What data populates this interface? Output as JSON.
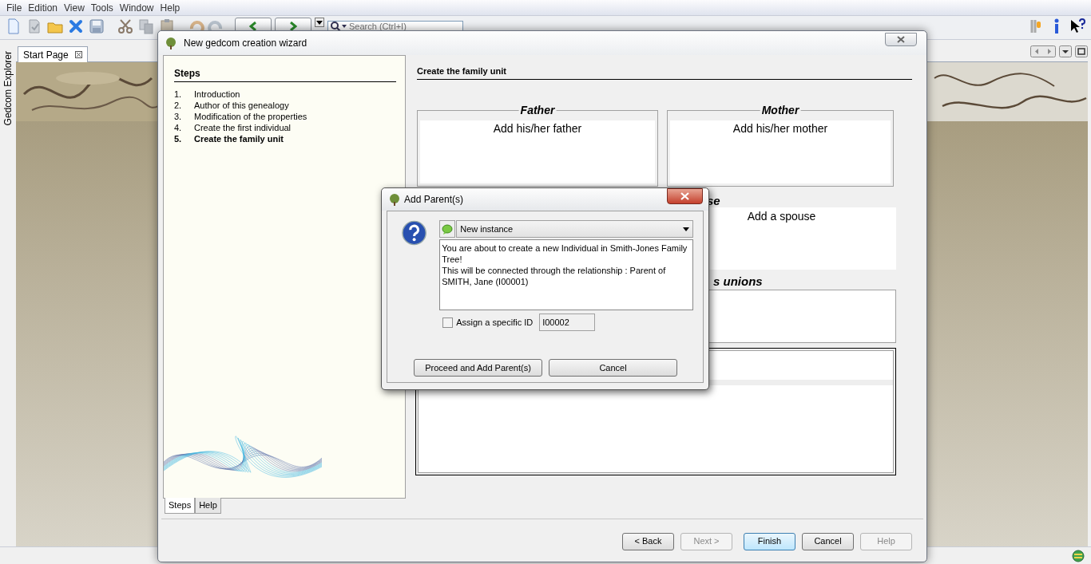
{
  "menu": [
    {
      "label": "File"
    },
    {
      "label": "Edition"
    },
    {
      "label": "View"
    },
    {
      "label": "Tools"
    },
    {
      "label": "Window"
    },
    {
      "label": "Help"
    }
  ],
  "toolbar": {
    "search": {
      "placeholder": "Search (Ctrl+I)"
    }
  },
  "side_tab": {
    "label": "Gedcom Explorer"
  },
  "document_tabs": [
    {
      "label": "Start Page",
      "selected": true
    }
  ],
  "wizard": {
    "title": "New gedcom creation wizard",
    "steps_title": "Steps",
    "steps": [
      {
        "number": "1.",
        "label": "Introduction",
        "selected": false
      },
      {
        "number": "2.",
        "label": "Author of this genealogy",
        "selected": false
      },
      {
        "number": "3.",
        "label": "Modification of the properties",
        "selected": false
      },
      {
        "number": "4.",
        "label": "Create the first individual",
        "selected": false
      },
      {
        "number": "5.",
        "label": "Create the family unit",
        "selected": true
      }
    ],
    "panel_tabs": [
      {
        "label": "Steps",
        "selected": true
      },
      {
        "label": "Help",
        "selected": false
      }
    ],
    "heading": "Create the family unit",
    "father": {
      "title": "Father",
      "action": "Add his/her father"
    },
    "mother": {
      "title": "Mother",
      "action": "Add his/her mother"
    },
    "spouse": {
      "title": "se",
      "action": "Add a spouse"
    },
    "unions": {
      "title": "s unions"
    },
    "buttons": [
      {
        "label": "< Back",
        "disabled": false,
        "default": false
      },
      {
        "label": "Next >",
        "disabled": true,
        "default": false
      },
      {
        "label": "Finish",
        "disabled": false,
        "default": true
      },
      {
        "label": "Cancel",
        "disabled": false,
        "default": false
      },
      {
        "label": "Help",
        "disabled": true,
        "default": false
      }
    ]
  },
  "dialog": {
    "title": "Add Parent(s)",
    "mode": "New instance",
    "message": [
      "You are about to create a new Individual in Smith-Jones Family Tree!",
      "This will be connected through the relationship : Parent of SMITH, Jane (I00001)"
    ],
    "assign_id": {
      "label": "Assign a specific ID",
      "checked": false,
      "value": "I00002"
    },
    "buttons": [
      {
        "label": "Proceed and Add Parent(s)"
      },
      {
        "label": "Cancel"
      }
    ]
  }
}
